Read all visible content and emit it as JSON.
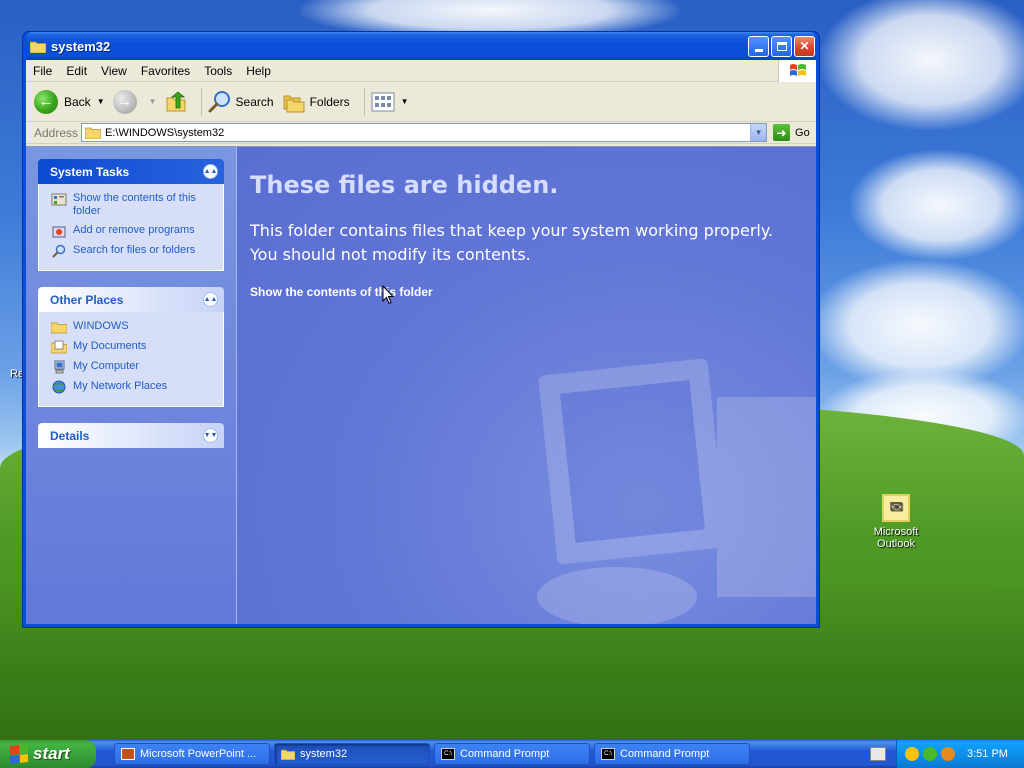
{
  "window": {
    "title": "system32",
    "menu": [
      "File",
      "Edit",
      "View",
      "Favorites",
      "Tools",
      "Help"
    ],
    "toolbar": {
      "back_label": "Back",
      "search_label": "Search",
      "folders_label": "Folders"
    },
    "address": {
      "label": "Address",
      "value": "E:\\WINDOWS\\system32",
      "go_label": "Go"
    }
  },
  "taskpane": {
    "system_tasks": {
      "title": "System Tasks",
      "items": [
        "Show the contents of this folder",
        "Add or remove programs",
        "Search for files or folders"
      ]
    },
    "other_places": {
      "title": "Other Places",
      "items": [
        "WINDOWS",
        "My Documents",
        "My Computer",
        "My Network Places"
      ]
    },
    "details": {
      "title": "Details"
    }
  },
  "main": {
    "heading": "These files are hidden.",
    "body_line1": "This folder contains files that keep your system working properly.",
    "body_line2": "You should not modify its contents.",
    "link": "Show the contents of this folder"
  },
  "desktop": {
    "icon_label_line1": "Microsoft",
    "icon_label_line2": "Outlook",
    "edge_label": "Re"
  },
  "taskbar": {
    "start_label": "start",
    "buttons": [
      "Microsoft PowerPoint ...",
      "system32",
      "Command Prompt",
      "Command Prompt"
    ],
    "clock": "3:51 PM"
  },
  "colors": {
    "title_blue": "#0a4fd8",
    "link_blue": "#215dc6",
    "main_bg": "#6276d6",
    "start_green": "#3c9a3c"
  }
}
